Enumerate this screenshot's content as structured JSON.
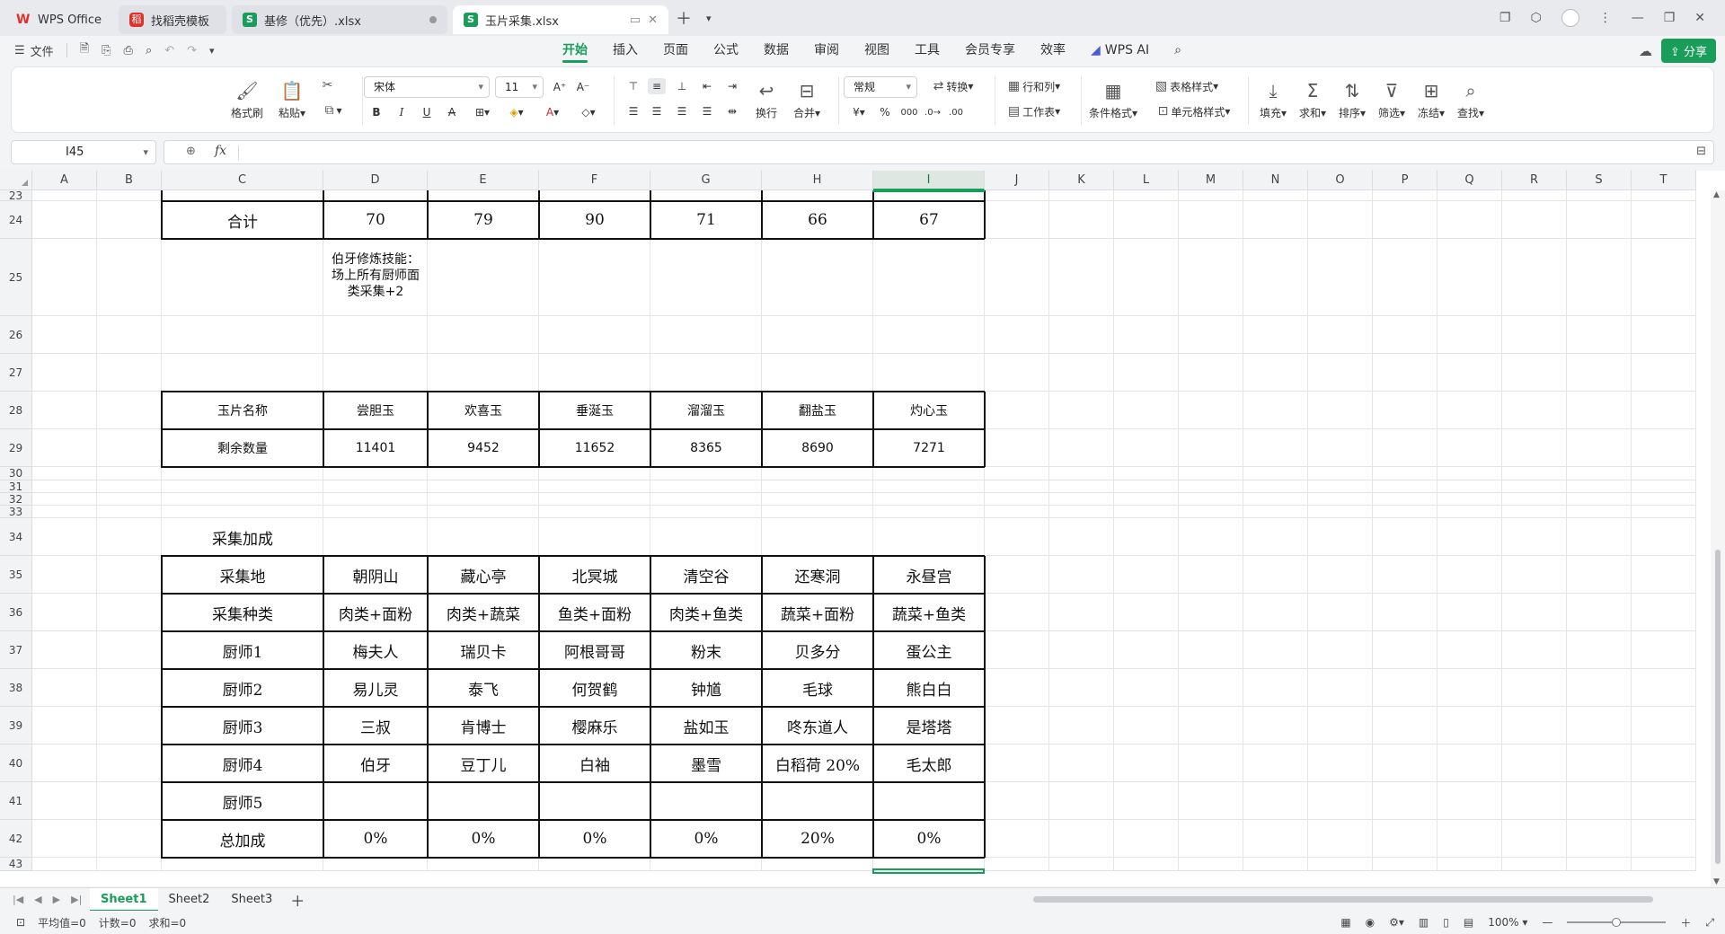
{
  "tabs": [
    {
      "label": "WPS Office",
      "icon": "wps-logo-icon"
    },
    {
      "label": "找稻壳模板",
      "icon": "docer-logo-icon"
    },
    {
      "label": "基修（优先）.xlsx",
      "icon": "spreadsheet-icon"
    },
    {
      "label": "玉片采集.xlsx",
      "icon": "spreadsheet-icon",
      "active": true
    }
  ],
  "menu": {
    "file_label": "文件",
    "tabs": [
      "开始",
      "插入",
      "页面",
      "公式",
      "数据",
      "审阅",
      "视图",
      "工具",
      "会员专享",
      "效率"
    ],
    "active_tab": "开始",
    "wps_ai_label": "WPS AI",
    "share_label": "分享"
  },
  "ribbon": {
    "format_painter": "格式刷",
    "paste": "粘贴",
    "font_name": "宋体",
    "font_size": "11",
    "wrap": "换行",
    "merge": "合并",
    "number_format": "常规",
    "convert": "转换",
    "row_col": "行和列",
    "worksheet": "工作表",
    "cond_format": "条件格式",
    "table_style": "表格样式",
    "cell_style": "单元格样式",
    "fill": "填充",
    "sum": "求和",
    "sort": "排序",
    "filter": "筛选",
    "freeze": "冻结",
    "find": "查找",
    "bold": "B",
    "italic": "I",
    "underline": "U"
  },
  "formula_bar": {
    "cell_ref": "I45",
    "fx_label": "fx",
    "content": ""
  },
  "columns": [
    "A",
    "B",
    "C",
    "D",
    "E",
    "F",
    "G",
    "H",
    "I",
    "J",
    "K",
    "L",
    "M",
    "N",
    "O",
    "P",
    "Q",
    "R",
    "S",
    "T"
  ],
  "selected_column": "I",
  "rows": [
    "23",
    "24",
    "25",
    "26",
    "27",
    "28",
    "29",
    "30",
    "31",
    "32",
    "33",
    "34",
    "35",
    "36",
    "37",
    "38",
    "39",
    "40",
    "41",
    "42",
    "43"
  ],
  "sheet": {
    "row24": [
      "合计",
      "70",
      "79",
      "90",
      "71",
      "66",
      "67"
    ],
    "note25": "伯牙修炼技能：场上所有厨师面类采集+2",
    "jade_header": [
      "玉片名称",
      "尝胆玉",
      "欢喜玉",
      "垂涎玉",
      "溜溜玉",
      "翻盐玉",
      "灼心玉"
    ],
    "jade_remaining": [
      "剩余数量",
      "11401",
      "9452",
      "11652",
      "8365",
      "8690",
      "7271"
    ],
    "section_title": "采集加成",
    "bonus_table": [
      [
        "采集地",
        "朝阴山",
        "藏心亭",
        "北冥城",
        "清空谷",
        "还寒洞",
        "永昼宫"
      ],
      [
        "采集种类",
        "肉类+面粉",
        "肉类+蔬菜",
        "鱼类+面粉",
        "肉类+鱼类",
        "蔬菜+面粉",
        "蔬菜+鱼类"
      ],
      [
        "厨师1",
        "梅夫人",
        "瑞贝卡",
        "阿根哥哥",
        "粉末",
        "贝多分",
        "蛋公主"
      ],
      [
        "厨师2",
        "易儿灵",
        "泰飞",
        "何贺鹤",
        "钟馗",
        "毛球",
        "熊白白"
      ],
      [
        "厨师3",
        "三叔",
        "肯博士",
        "樱麻乐",
        "盐如玉",
        "咚东道人",
        "是塔塔"
      ],
      [
        "厨师4",
        "伯牙",
        "豆丁儿",
        "白袖",
        "墨雪",
        "白稻荷  20%",
        "毛太郎"
      ],
      [
        "厨师5",
        "",
        "",
        "",
        "",
        "",
        ""
      ],
      [
        "总加成",
        "0%",
        "0%",
        "0%",
        "0%",
        "20%",
        "0%"
      ]
    ]
  },
  "sheet_tabs": [
    "Sheet1",
    "Sheet2",
    "Sheet3"
  ],
  "active_sheet": "Sheet1",
  "status": {
    "average": "平均值=0",
    "count": "计数=0",
    "sum": "求和=0",
    "zoom": "100%"
  }
}
